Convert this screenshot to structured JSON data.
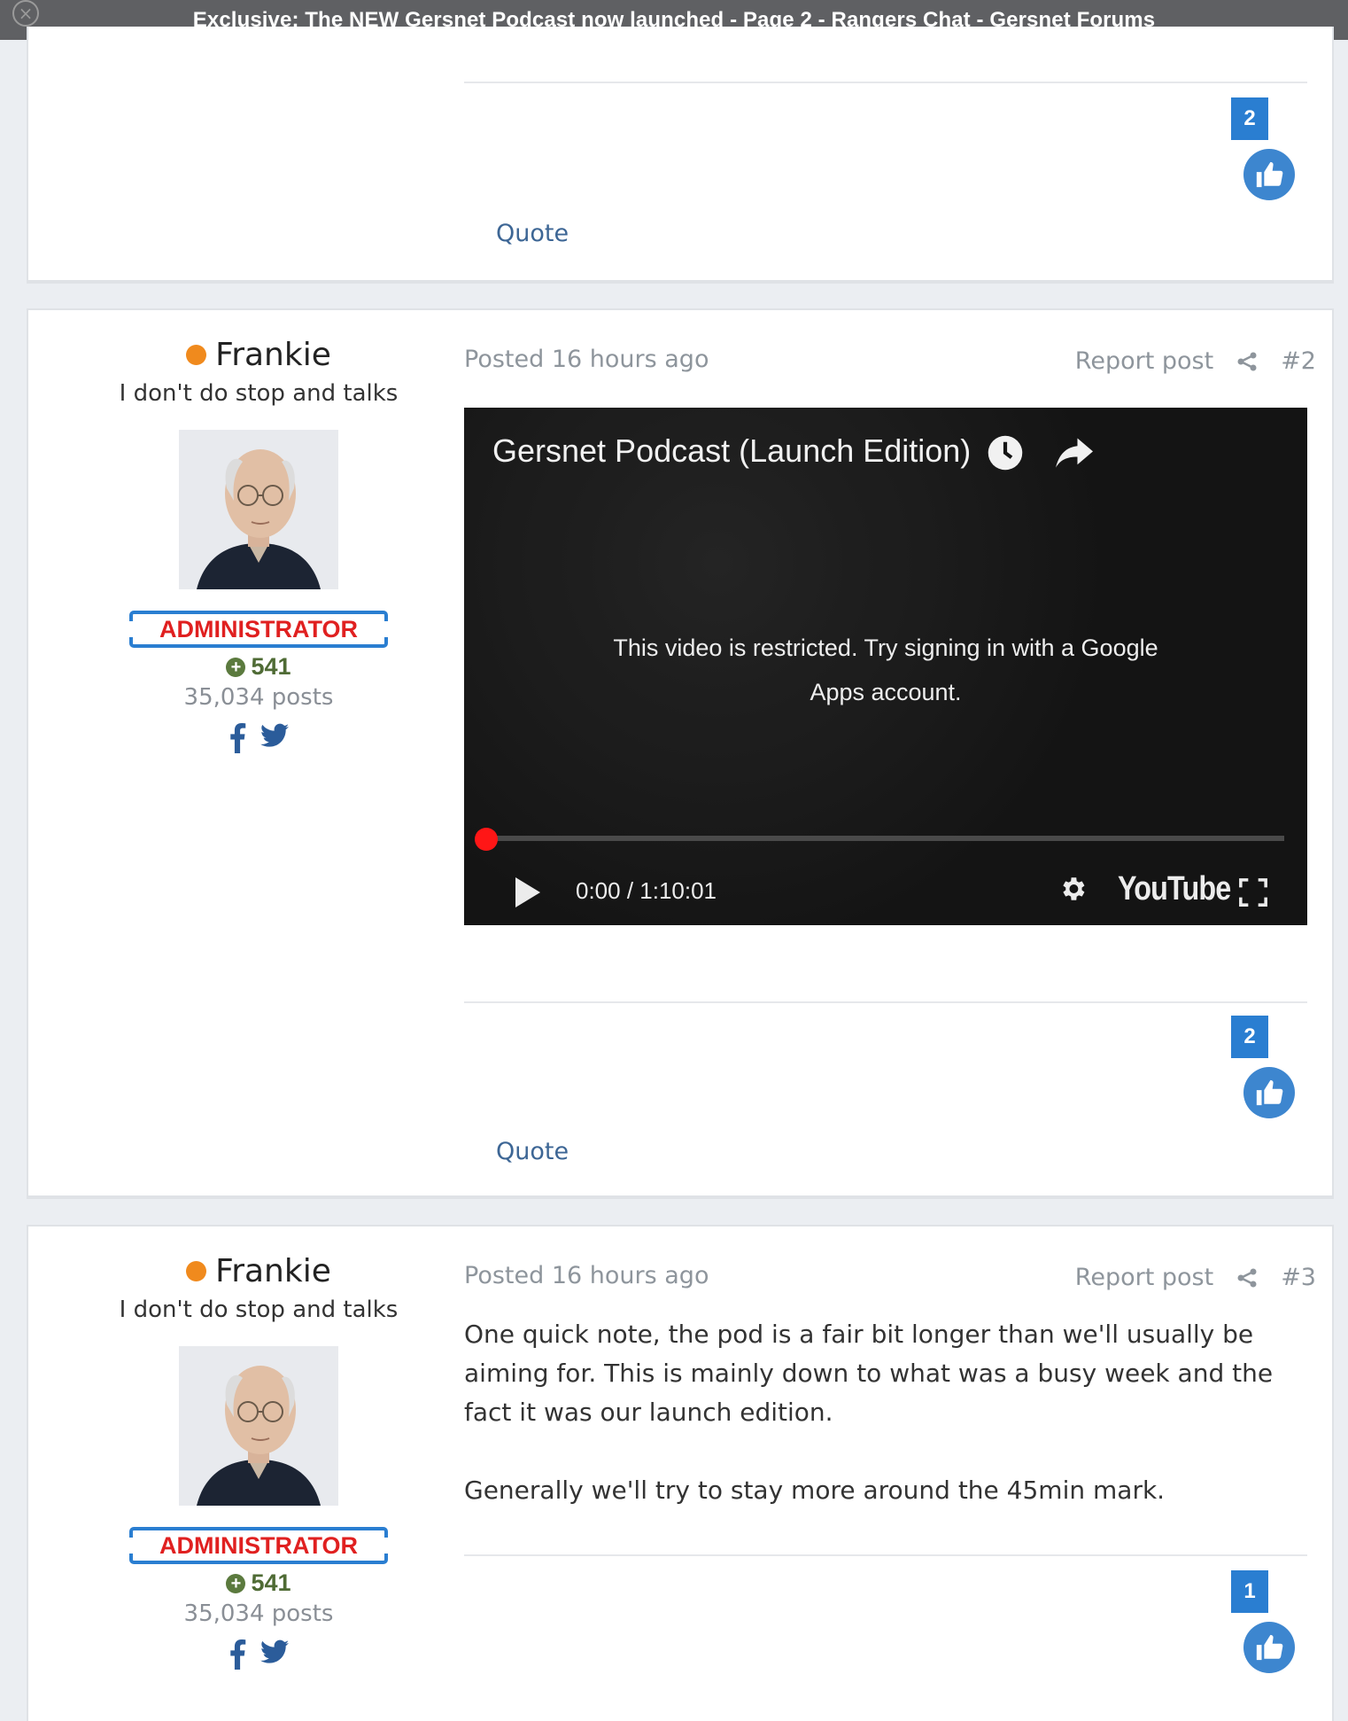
{
  "window": {
    "title": "Exclusive: The NEW Gersnet Podcast now launched - Page 2 - Rangers Chat - Gersnet Forums"
  },
  "posts": [
    {
      "reputation_count": "2",
      "quote_label": "Quote"
    },
    {
      "author": {
        "name": "Frankie",
        "title": "I don't do stop and talks",
        "badge": "ADMINISTRATOR",
        "reputation": "541",
        "post_count": "35,034 posts"
      },
      "posted": "Posted 16 hours ago",
      "report_label": "Report post",
      "number": "#2",
      "video": {
        "title": "Gersnet Podcast (Launch Edition)",
        "message": "This video is restricted. Try signing in with a Google Apps account.",
        "time": "0:00 / 1:10:01",
        "logo": "YouTube",
        "progress": 0
      },
      "reputation_count": "2",
      "quote_label": "Quote"
    },
    {
      "author": {
        "name": "Frankie",
        "title": "I don't do stop and talks",
        "badge": "ADMINISTRATOR",
        "reputation": "541",
        "post_count": "35,034 posts"
      },
      "posted": "Posted 16 hours ago",
      "report_label": "Report post",
      "number": "#3",
      "body": [
        "One quick note, the pod is a fair bit longer than we'll usually be aiming for.  This is mainly down to what was a busy week and the fact it was our launch edition.",
        "Generally we'll try to stay more around the 45min mark."
      ],
      "reputation_count": "1"
    }
  ],
  "colors": {
    "accent": "#2a7ed1",
    "like": "#3d86cf",
    "online": "#f08a1d",
    "admin_red": "#e02020",
    "admin_border": "#2a7ed1",
    "rep_green": "#4f6b35",
    "link": "#3d6695"
  },
  "icons": [
    "close-icon",
    "thumbs-up-icon",
    "facebook-icon",
    "twitter-icon",
    "share-icon",
    "clock-icon",
    "share-arrow-icon",
    "play-icon",
    "gear-icon",
    "fullscreen-icon"
  ]
}
